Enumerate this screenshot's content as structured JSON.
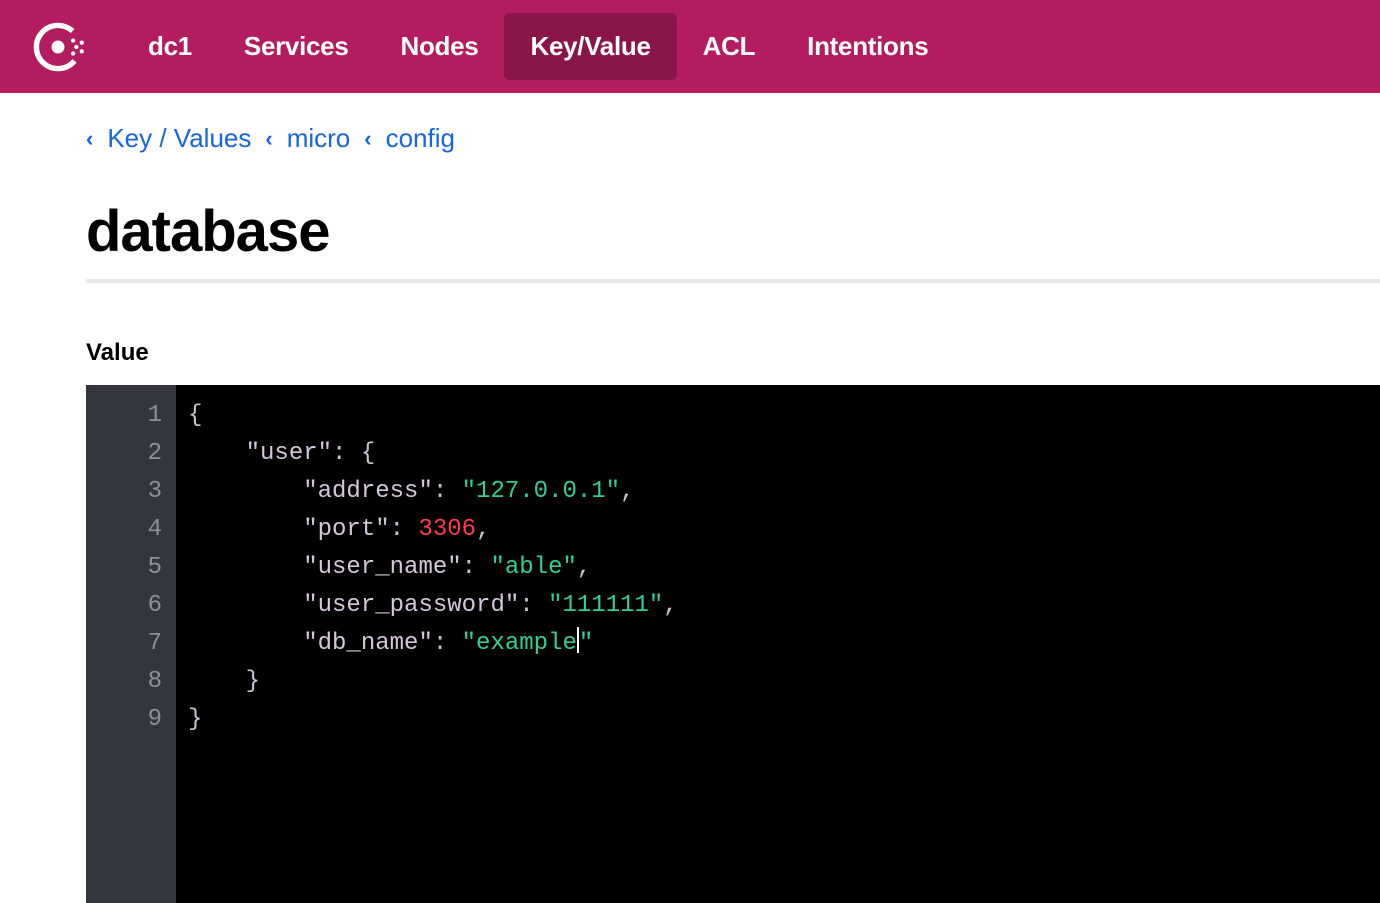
{
  "nav": {
    "items": [
      {
        "label": "dc1",
        "active": false
      },
      {
        "label": "Services",
        "active": false
      },
      {
        "label": "Nodes",
        "active": false
      },
      {
        "label": "Key/Value",
        "active": true
      },
      {
        "label": "ACL",
        "active": false
      },
      {
        "label": "Intentions",
        "active": false
      }
    ]
  },
  "breadcrumb": {
    "items": [
      "Key / Values",
      "micro",
      "config"
    ]
  },
  "page": {
    "title": "database",
    "value_label": "Value"
  },
  "editor": {
    "lines": [
      "1",
      "2",
      "3",
      "4",
      "5",
      "6",
      "7",
      "8",
      "9"
    ],
    "code": {
      "l1_open": "{",
      "l2_key": "\"user\"",
      "l2_sep": ": {",
      "l3_key": "\"address\"",
      "l3_colon": ": ",
      "l3_val": "\"127.0.0.1\"",
      "l3_comma": ",",
      "l4_key": "\"port\"",
      "l4_colon": ": ",
      "l4_val": "3306",
      "l4_comma": ",",
      "l5_key": "\"user_name\"",
      "l5_colon": ": ",
      "l5_val": "\"able\"",
      "l5_comma": ",",
      "l6_key": "\"user_password\"",
      "l6_colon": ": ",
      "l6_val": "\"111111\"",
      "l6_comma": ",",
      "l7_key": "\"db_name\"",
      "l7_colon": ": ",
      "l7_val_pre": "\"example",
      "l7_val_post": "\"",
      "l8_close": "}",
      "l9_close": "}"
    }
  }
}
